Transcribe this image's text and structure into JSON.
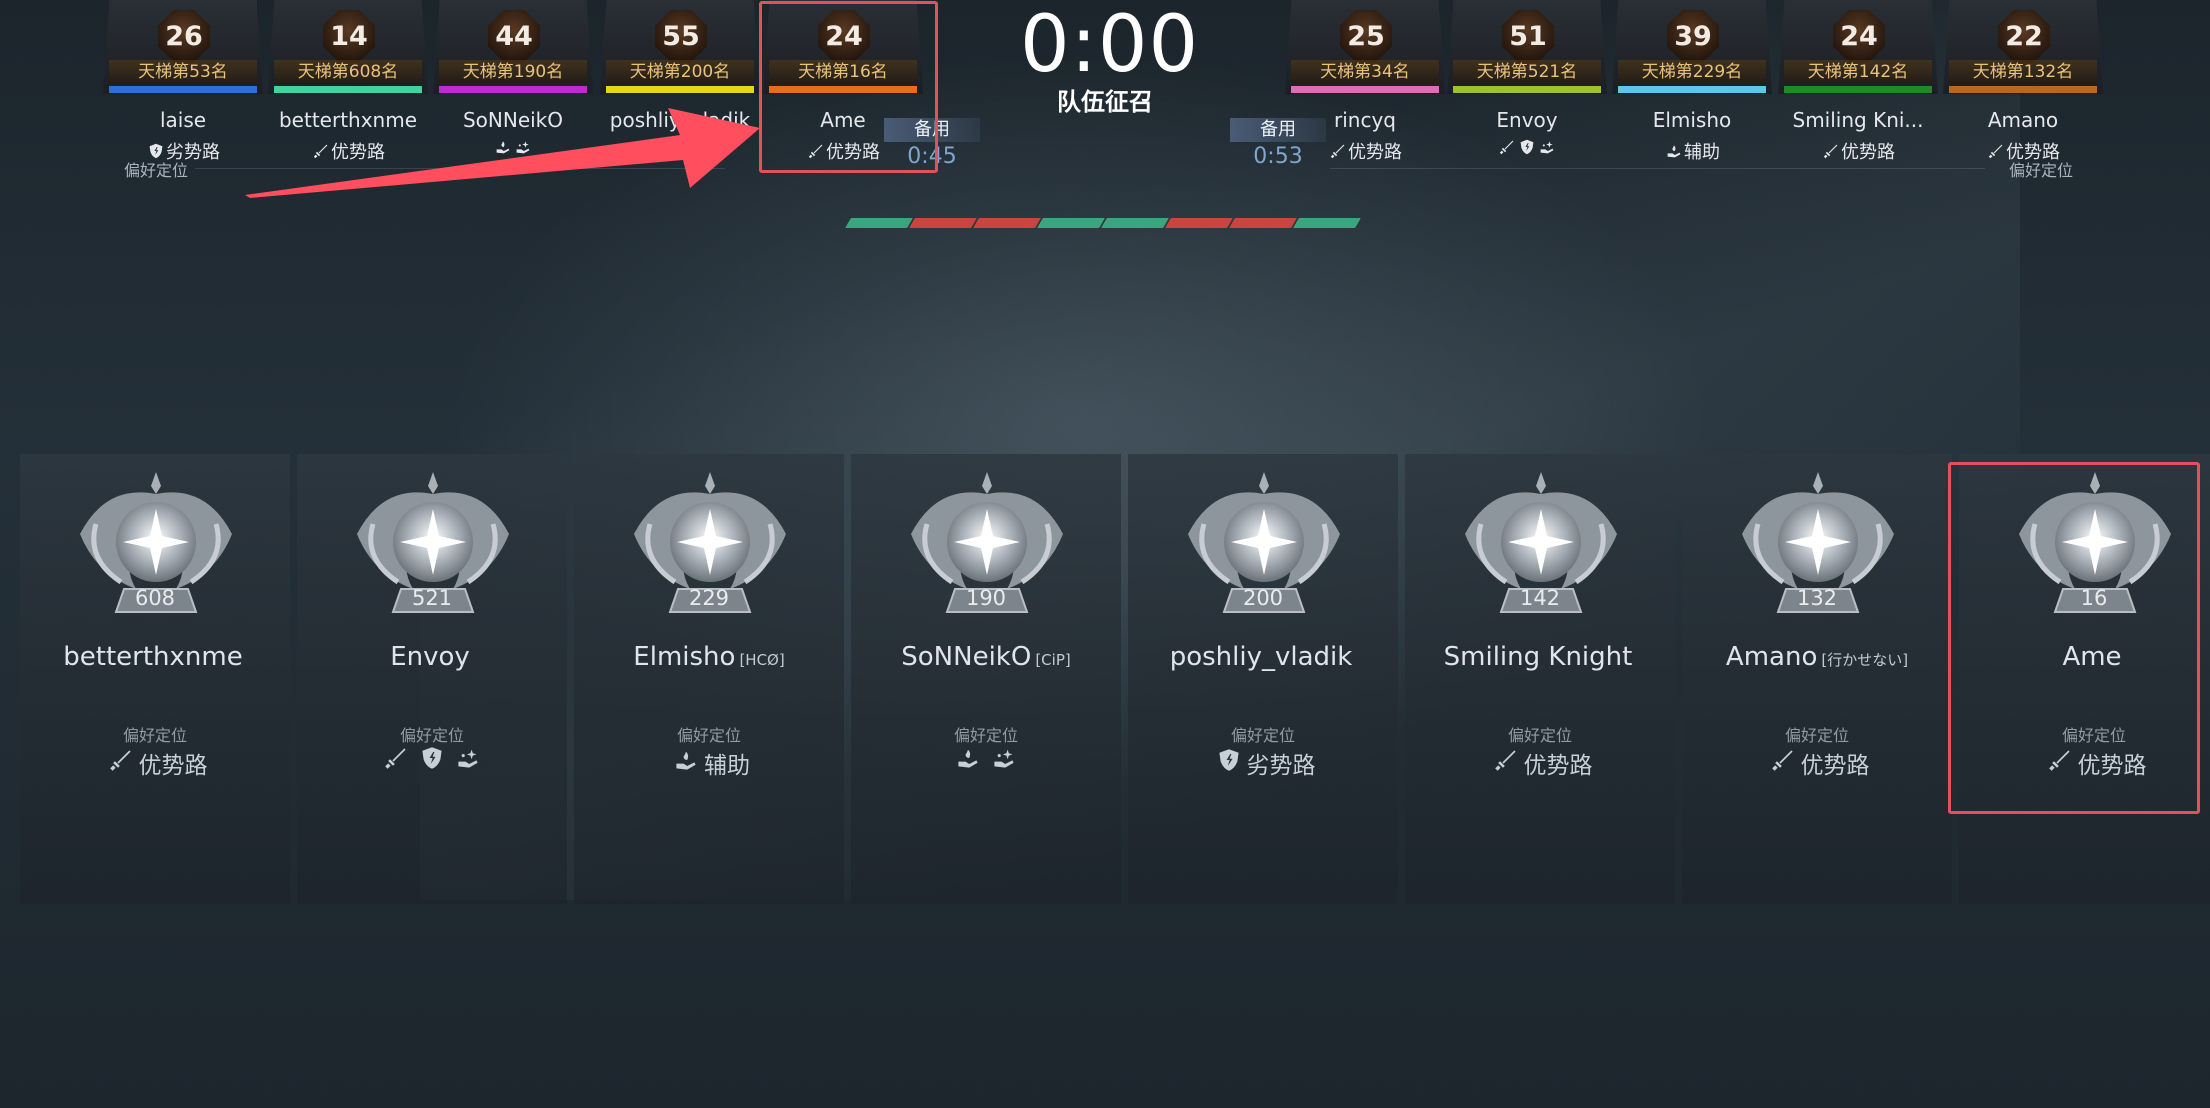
{
  "header": {
    "timer": "0:00",
    "subtitle": "队伍征召",
    "pref_label": "偏好定位"
  },
  "reserve_left": {
    "label": "备用",
    "time": "0:45"
  },
  "reserve_right": {
    "label": "备用",
    "time": "0:53"
  },
  "pick_track": [
    "#3aa57f",
    "#c8463b",
    "#c8463b",
    "#3aa57f",
    "#3aa57f",
    "#c8463b",
    "#c8463b",
    "#3aa57f"
  ],
  "top_left": [
    {
      "level": "26",
      "rank": "天梯第53名",
      "name": "laise",
      "role": "劣势路",
      "icons": [
        "shield-icon"
      ],
      "color": "#2e6fd8"
    },
    {
      "level": "14",
      "rank": "天梯第608名",
      "name": "betterthxnme",
      "role": "优势路",
      "icons": [
        "sword-icon"
      ],
      "color": "#3fd3a0"
    },
    {
      "level": "44",
      "rank": "天梯第190名",
      "name": "SoNNeikO",
      "role": "",
      "icons": [
        "hand-icon",
        "hand2-icon"
      ],
      "color": "#c02ad0"
    },
    {
      "level": "55",
      "rank": "天梯第200名",
      "name": "poshliy_vladik",
      "role": "",
      "icons": [],
      "color": "#e6d61a"
    },
    {
      "level": "24",
      "rank": "天梯第16名",
      "name": "Ame",
      "role": "优势路",
      "icons": [
        "sword-icon"
      ],
      "color": "#e66e18"
    }
  ],
  "top_right": [
    {
      "level": "25",
      "rank": "天梯第34名",
      "name": "rincyq",
      "role": "优势路",
      "icons": [
        "sword-icon"
      ],
      "color": "#e06cb8"
    },
    {
      "level": "51",
      "rank": "天梯第521名",
      "name": "Envoy",
      "role": "",
      "icons": [
        "sword-icon",
        "shield-icon",
        "hand2-icon"
      ],
      "color": "#9ec22a"
    },
    {
      "level": "39",
      "rank": "天梯第229名",
      "name": "Elmisho",
      "role": "辅助",
      "icons": [
        "hand-icon"
      ],
      "color": "#5cc7e6"
    },
    {
      "level": "24",
      "rank": "天梯第142名",
      "name": "Smiling Kni...",
      "role": "优势路",
      "icons": [
        "sword-icon"
      ],
      "color": "#1f8a2c"
    },
    {
      "level": "22",
      "rank": "天梯第132名",
      "name": "Amano",
      "role": "优势路",
      "icons": [
        "sword-icon"
      ],
      "color": "#b86a1a"
    }
  ],
  "cards": [
    {
      "rank": "608",
      "name": "betterthxnme",
      "tag": "",
      "label": "偏好定位",
      "role": "优势路",
      "icons": [
        "sword-icon"
      ]
    },
    {
      "rank": "521",
      "name": "Envoy",
      "tag": "",
      "label": "偏好定位",
      "role": "",
      "icons": [
        "sword-icon",
        "shield-icon",
        "hand2-icon"
      ]
    },
    {
      "rank": "229",
      "name": "Elmisho",
      "tag": "[HCØ]",
      "label": "偏好定位",
      "role": "辅助",
      "icons": [
        "hand-icon"
      ]
    },
    {
      "rank": "190",
      "name": "SoNNeikO",
      "tag": "[CiP]",
      "label": "偏好定位",
      "role": "",
      "icons": [
        "hand-icon",
        "hand2-icon"
      ]
    },
    {
      "rank": "200",
      "name": "poshliy_vladik",
      "tag": "",
      "label": "偏好定位",
      "role": "劣势路",
      "icons": [
        "shield-icon"
      ]
    },
    {
      "rank": "142",
      "name": "Smiling Knight",
      "tag": "",
      "label": "偏好定位",
      "role": "优势路",
      "icons": [
        "sword-icon"
      ]
    },
    {
      "rank": "132",
      "name": "Amano",
      "tag": "[行かせない]",
      "label": "偏好定位",
      "role": "优势路",
      "icons": [
        "sword-icon"
      ]
    },
    {
      "rank": "16",
      "name": "Ame",
      "tag": "",
      "label": "偏好定位",
      "role": "优势路",
      "icons": [
        "sword-icon"
      ]
    }
  ]
}
